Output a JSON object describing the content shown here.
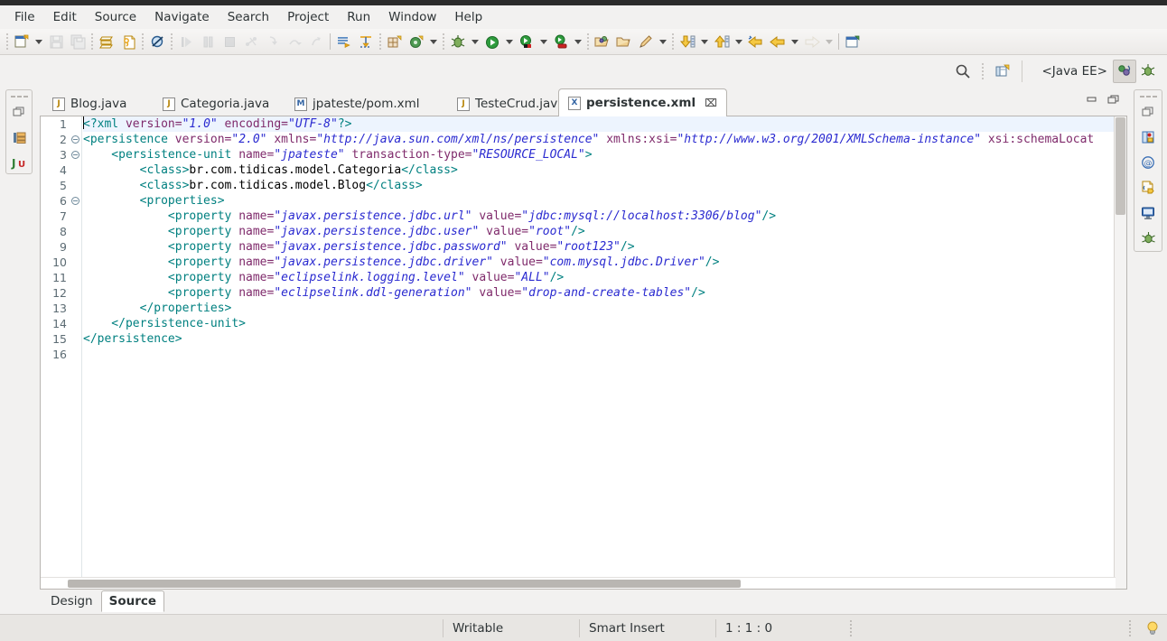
{
  "menu": {
    "items": [
      {
        "label": "File",
        "mnemonic_index": 0
      },
      {
        "label": "Edit",
        "mnemonic_index": 0
      },
      {
        "label": "Source",
        "mnemonic_index": 0
      },
      {
        "label": "Navigate",
        "mnemonic_index": 0
      },
      {
        "label": "Search",
        "mnemonic_index": 0
      },
      {
        "label": "Project",
        "mnemonic_index": 0
      },
      {
        "label": "Run",
        "mnemonic_index": 0
      },
      {
        "label": "Window",
        "mnemonic_index": 0
      },
      {
        "label": "Help",
        "mnemonic_index": 0
      }
    ]
  },
  "toolbar": {
    "buttons": [
      {
        "name": "new-wizard",
        "icon": "new-file-icon",
        "enabled": true,
        "dropdown": true
      },
      {
        "name": "save",
        "icon": "save-icon",
        "enabled": false
      },
      {
        "name": "save-all",
        "icon": "save-all-icon",
        "enabled": false
      },
      {
        "name": "print-preview",
        "icon": "print-icon",
        "enabled": true
      },
      {
        "name": "export-xml",
        "icon": "xml-export-icon",
        "enabled": true
      },
      {
        "name": "skip-breakpoints",
        "icon": "skip-breakpoints-icon",
        "enabled": true
      },
      {
        "name": "resume",
        "icon": "resume-icon",
        "enabled": false
      },
      {
        "name": "suspend",
        "icon": "suspend-icon",
        "enabled": false
      },
      {
        "name": "terminate",
        "icon": "terminate-icon",
        "enabled": false
      },
      {
        "name": "disconnect",
        "icon": "disconnect-icon",
        "enabled": false
      },
      {
        "name": "step-into",
        "icon": "step-into-icon",
        "enabled": false
      },
      {
        "name": "step-over",
        "icon": "step-over-icon",
        "enabled": false
      },
      {
        "name": "step-return",
        "icon": "step-return-icon",
        "enabled": false
      },
      {
        "name": "toggle-mark-occurrences",
        "icon": "mark-occurrences-icon",
        "enabled": true
      },
      {
        "name": "open-task",
        "icon": "open-task-icon",
        "enabled": true
      },
      {
        "name": "new-java-package",
        "icon": "new-package-icon",
        "enabled": true
      },
      {
        "name": "new-java-class",
        "icon": "new-class-icon",
        "enabled": true,
        "dropdown": true
      },
      {
        "name": "debug",
        "icon": "debug-bug-icon",
        "enabled": true,
        "dropdown": true
      },
      {
        "name": "run",
        "icon": "run-play-icon",
        "enabled": true,
        "dropdown": true
      },
      {
        "name": "coverage",
        "icon": "coverage-icon",
        "enabled": true,
        "dropdown": true
      },
      {
        "name": "run-external-tools",
        "icon": "external-tools-icon",
        "enabled": true,
        "dropdown": true
      },
      {
        "name": "open-type",
        "icon": "open-type-icon",
        "enabled": true
      },
      {
        "name": "open-resource",
        "icon": "open-resource-icon",
        "enabled": true
      },
      {
        "name": "search",
        "icon": "pencil-search-icon",
        "enabled": true,
        "dropdown": true
      },
      {
        "name": "next-annotation",
        "icon": "next-annotation-icon",
        "enabled": true,
        "dropdown": true
      },
      {
        "name": "previous-annotation",
        "icon": "previous-annotation-icon",
        "enabled": true,
        "dropdown": true
      },
      {
        "name": "last-edit-location",
        "icon": "last-edit-location-icon",
        "enabled": true
      },
      {
        "name": "back",
        "icon": "back-arrow-icon",
        "enabled": true,
        "dropdown": true
      },
      {
        "name": "forward",
        "icon": "forward-arrow-icon",
        "enabled": false,
        "dropdown": true
      },
      {
        "name": "new-editor-window",
        "icon": "new-window-icon",
        "enabled": true
      }
    ]
  },
  "perspective": {
    "search_icon": "search-icon",
    "open_perspective_icon": "open-perspective-icon",
    "current": "<Java EE>",
    "buttons": [
      {
        "name": "perspective-java-ee",
        "icon": "java-ee-perspective-icon",
        "active": true
      },
      {
        "name": "perspective-debug",
        "icon": "debug-perspective-icon",
        "active": false
      }
    ]
  },
  "left_minibar": {
    "icons": [
      {
        "name": "restore-icon",
        "label": "restore"
      },
      {
        "name": "project-explorer-icon",
        "label": "Project Explorer"
      },
      {
        "name": "junit-icon",
        "label": "JUnit"
      }
    ]
  },
  "right_minibar": {
    "icons": [
      {
        "name": "restore-icon",
        "label": "restore"
      },
      {
        "name": "servers-icon",
        "label": "Servers"
      },
      {
        "name": "annotations-icon",
        "label": "Annotations"
      },
      {
        "name": "snippets-icon",
        "label": "Snippets"
      },
      {
        "name": "console-icon",
        "label": "Console"
      },
      {
        "name": "debug-icon",
        "label": "Debug"
      }
    ]
  },
  "editor": {
    "tabs": [
      {
        "label": "Blog.java",
        "icon": "java-file-icon",
        "icon_letter": "J",
        "active": false,
        "closable": false
      },
      {
        "label": "Categoria.java",
        "icon": "java-file-icon",
        "icon_letter": "J",
        "active": false,
        "closable": false
      },
      {
        "label": "jpateste/pom.xml",
        "icon": "maven-file-icon",
        "icon_letter": "M",
        "active": false,
        "closable": false
      },
      {
        "label": "TesteCrud.java",
        "icon": "java-file-icon",
        "icon_letter": "J",
        "active": false,
        "closable": false
      },
      {
        "label": "persistence.xml",
        "icon": "xml-file-icon",
        "icon_letter": "X",
        "active": true,
        "closable": true,
        "close_glyph": "⌧"
      }
    ],
    "window_buttons": [
      {
        "name": "minimize-editor-icon",
        "glyph": "minimize"
      },
      {
        "name": "maximize-editor-icon",
        "glyph": "maximize"
      }
    ],
    "bottom_tabs": [
      {
        "label": "Design",
        "active": false
      },
      {
        "label": "Source",
        "active": true
      }
    ],
    "line_numbers": [
      1,
      2,
      3,
      4,
      5,
      6,
      7,
      8,
      9,
      10,
      11,
      12,
      13,
      14,
      15,
      16
    ],
    "fold_lines": [
      2,
      3,
      6
    ],
    "code_lines": [
      {
        "n": 1,
        "tokens": [
          {
            "t": "<?xml ",
            "c": "x-pi"
          },
          {
            "t": "version=",
            "c": "x-attr"
          },
          {
            "t": "\"1.0\"",
            "c": "x-val"
          },
          {
            "t": " encoding=",
            "c": "x-attr"
          },
          {
            "t": "\"UTF-8\"",
            "c": "x-val"
          },
          {
            "t": "?>",
            "c": "x-pi"
          }
        ]
      },
      {
        "n": 2,
        "tokens": [
          {
            "t": "<persistence",
            "c": "x-tag"
          },
          {
            "t": " version=",
            "c": "x-attr"
          },
          {
            "t": "\"2.0\"",
            "c": "x-val"
          },
          {
            "t": " xmlns=",
            "c": "x-attr"
          },
          {
            "t": "\"http://java.sun.com/xml/ns/persistence\"",
            "c": "x-val"
          },
          {
            "t": " xmlns:xsi=",
            "c": "x-attr"
          },
          {
            "t": "\"http://www.w3.org/2001/XMLSchema-instance\"",
            "c": "x-val"
          },
          {
            "t": " xsi:schemaLocat",
            "c": "x-attr"
          }
        ]
      },
      {
        "n": 3,
        "tokens": [
          {
            "t": "    <persistence-unit",
            "c": "x-tag"
          },
          {
            "t": " name=",
            "c": "x-attr"
          },
          {
            "t": "\"jpateste\"",
            "c": "x-val"
          },
          {
            "t": " transaction-type=",
            "c": "x-attr"
          },
          {
            "t": "\"RESOURCE_LOCAL\"",
            "c": "x-val"
          },
          {
            "t": ">",
            "c": "x-tag"
          }
        ]
      },
      {
        "n": 4,
        "tokens": [
          {
            "t": "        <class>",
            "c": "x-tag"
          },
          {
            "t": "br.com.tidicas.model.Categoria",
            "c": "x-text"
          },
          {
            "t": "</class>",
            "c": "x-tag"
          }
        ]
      },
      {
        "n": 5,
        "tokens": [
          {
            "t": "        <class>",
            "c": "x-tag"
          },
          {
            "t": "br.com.tidicas.model.Blog",
            "c": "x-text"
          },
          {
            "t": "</class>",
            "c": "x-tag"
          }
        ]
      },
      {
        "n": 6,
        "tokens": [
          {
            "t": "        <properties>",
            "c": "x-tag"
          }
        ]
      },
      {
        "n": 7,
        "tokens": [
          {
            "t": "            <property",
            "c": "x-tag"
          },
          {
            "t": " name=",
            "c": "x-attr"
          },
          {
            "t": "\"javax.persistence.jdbc.url\"",
            "c": "x-val"
          },
          {
            "t": " value=",
            "c": "x-attr"
          },
          {
            "t": "\"jdbc:mysql://localhost:3306/blog\"",
            "c": "x-val"
          },
          {
            "t": "/>",
            "c": "x-tag"
          }
        ]
      },
      {
        "n": 8,
        "tokens": [
          {
            "t": "            <property",
            "c": "x-tag"
          },
          {
            "t": " name=",
            "c": "x-attr"
          },
          {
            "t": "\"javax.persistence.jdbc.user\"",
            "c": "x-val"
          },
          {
            "t": " value=",
            "c": "x-attr"
          },
          {
            "t": "\"root\"",
            "c": "x-val"
          },
          {
            "t": "/>",
            "c": "x-tag"
          }
        ]
      },
      {
        "n": 9,
        "tokens": [
          {
            "t": "            <property",
            "c": "x-tag"
          },
          {
            "t": " name=",
            "c": "x-attr"
          },
          {
            "t": "\"javax.persistence.jdbc.password\"",
            "c": "x-val"
          },
          {
            "t": " value=",
            "c": "x-attr"
          },
          {
            "t": "\"root123\"",
            "c": "x-val"
          },
          {
            "t": "/>",
            "c": "x-tag"
          }
        ]
      },
      {
        "n": 10,
        "tokens": [
          {
            "t": "            <property",
            "c": "x-tag"
          },
          {
            "t": " name=",
            "c": "x-attr"
          },
          {
            "t": "\"javax.persistence.jdbc.driver\"",
            "c": "x-val"
          },
          {
            "t": " value=",
            "c": "x-attr"
          },
          {
            "t": "\"com.mysql.jdbc.Driver\"",
            "c": "x-val"
          },
          {
            "t": "/>",
            "c": "x-tag"
          }
        ]
      },
      {
        "n": 11,
        "tokens": [
          {
            "t": "            <property",
            "c": "x-tag"
          },
          {
            "t": " name=",
            "c": "x-attr"
          },
          {
            "t": "\"eclipselink.logging.level\"",
            "c": "x-val"
          },
          {
            "t": " value=",
            "c": "x-attr"
          },
          {
            "t": "\"ALL\"",
            "c": "x-val"
          },
          {
            "t": "/>",
            "c": "x-tag"
          }
        ]
      },
      {
        "n": 12,
        "tokens": [
          {
            "t": "            <property",
            "c": "x-tag"
          },
          {
            "t": " name=",
            "c": "x-attr"
          },
          {
            "t": "\"eclipselink.ddl-generation\"",
            "c": "x-val"
          },
          {
            "t": " value=",
            "c": "x-attr"
          },
          {
            "t": "\"drop-and-create-tables\"",
            "c": "x-val"
          },
          {
            "t": "/>",
            "c": "x-tag"
          }
        ]
      },
      {
        "n": 13,
        "tokens": [
          {
            "t": "        </properties>",
            "c": "x-tag"
          }
        ]
      },
      {
        "n": 14,
        "tokens": [
          {
            "t": "    </persistence-unit>",
            "c": "x-tag"
          }
        ]
      },
      {
        "n": 15,
        "tokens": [
          {
            "t": "</persistence>",
            "c": "x-tag"
          }
        ]
      },
      {
        "n": 16,
        "tokens": []
      }
    ]
  },
  "statusbar": {
    "writable": "Writable",
    "insert_mode": "Smart Insert",
    "position": "1 : 1 : 0",
    "hint_icon": "lightbulb-icon"
  },
  "colors": {
    "chrome": "#f2f1f0",
    "editor_bg": "#ffffff",
    "tag": "#008080",
    "attr": "#7f2a6b",
    "value": "#2a2ad0",
    "text": "#000000",
    "current_line": "#edf4fe",
    "accent": "#3465a4"
  }
}
